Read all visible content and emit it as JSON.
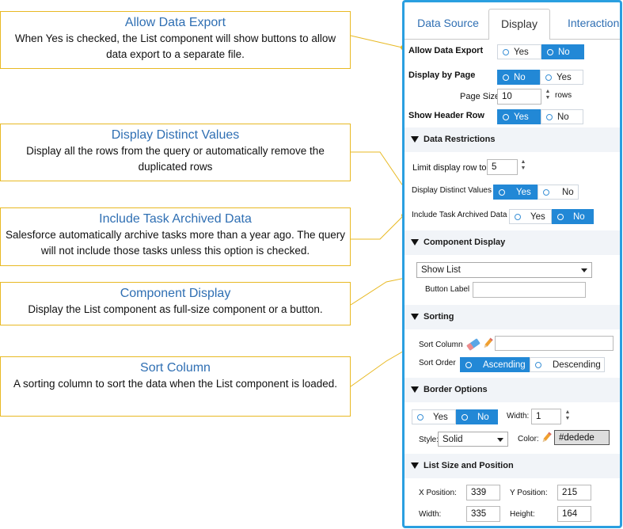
{
  "callouts": [
    {
      "title": "Allow Data Export",
      "body": "When Yes is checked, the List component will show buttons to allow data export to a separate file."
    },
    {
      "title": "Display Distinct Values",
      "body": "Display all the rows from the query or automatically remove the duplicated rows"
    },
    {
      "title": "Include Task Archived Data",
      "body": "Salesforce automatically archive tasks more than a year ago. The query will not include those tasks unless this option is checked."
    },
    {
      "title": "Component Display",
      "body": "Display the List component as full-size component or a button."
    },
    {
      "title": "Sort Column",
      "body": "A sorting column to sort the data when the List component is loaded."
    }
  ],
  "tabs": {
    "data_source": "Data Source",
    "display": "Display",
    "interaction": "Interaction"
  },
  "allow_export": {
    "label": "Allow Data Export",
    "yes": "Yes",
    "no": "No",
    "selected": "No"
  },
  "display_by_page": {
    "label": "Display by Page",
    "no": "No",
    "yes": "Yes",
    "selected": "No"
  },
  "page_size": {
    "label": "Page Size",
    "value": "10",
    "unit": "rows"
  },
  "show_header": {
    "label": "Show Header Row",
    "yes": "Yes",
    "no": "No",
    "selected": "Yes"
  },
  "data_restrictions": {
    "title": "Data Restrictions",
    "limit_label": "Limit display row to",
    "limit_value": "5",
    "distinct_label": "Display Distinct Values",
    "distinct_yes": "Yes",
    "distinct_no": "No",
    "distinct_selected": "Yes",
    "archived_label": "Include Task Archived Data",
    "archived_yes": "Yes",
    "archived_no": "No",
    "archived_selected": "No"
  },
  "component_display": {
    "title": "Component Display",
    "select_value": "Show List",
    "button_label": "Button Label",
    "button_value": ""
  },
  "sorting": {
    "title": "Sorting",
    "column_label": "Sort Column",
    "column_value": "",
    "order_label": "Sort Order",
    "ascending": "Ascending",
    "descending": "Descending",
    "selected": "Ascending"
  },
  "border": {
    "title": "Border Options",
    "yes": "Yes",
    "no": "No",
    "selected": "No",
    "width_label": "Width:",
    "width_value": "1",
    "style_label": "Style:",
    "style_value": "Solid",
    "color_label": "Color:",
    "color_value": "#dedede"
  },
  "size": {
    "title": "List Size and Position",
    "x_label": "X Position:",
    "x_value": "339",
    "y_label": "Y Position:",
    "y_value": "215",
    "w_label": "Width:",
    "w_value": "335",
    "h_label": "Height:",
    "h_value": "164"
  },
  "colors": {
    "accent": "#2288d6",
    "panel_border": "#2a9fe0",
    "callout_border": "#e8b923",
    "callout_title": "#2f6fb3"
  }
}
